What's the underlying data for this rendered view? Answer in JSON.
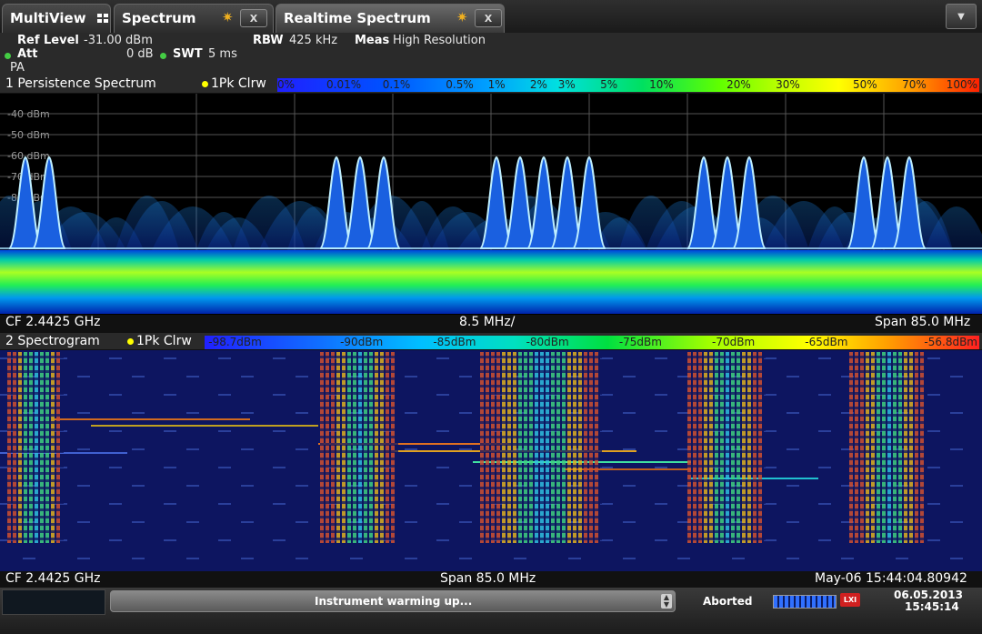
{
  "tabs": [
    {
      "label": "MultiView"
    },
    {
      "label": "Spectrum",
      "close": "X"
    },
    {
      "label": "Realtime Spectrum",
      "close": "X"
    }
  ],
  "menu_button": "▼",
  "params": {
    "ref_level_label": "Ref Level",
    "ref_level_value": "-31.00 dBm",
    "att_label": "Att",
    "att_value": "0 dB",
    "swt_label": "SWT",
    "swt_value": "5 ms",
    "rbw_label": "RBW",
    "rbw_value": "425 kHz",
    "meas_label": "Meas",
    "meas_value": "High Resolution",
    "pa_label": "PA"
  },
  "persistence": {
    "title": "1 Persistence Spectrum",
    "trace": "1Pk Clrw",
    "scale": [
      "0%",
      "0.01%",
      "0.1%",
      "0.5%",
      "1%",
      "2%",
      "3%",
      "5%",
      "10%",
      "20%",
      "30%",
      "50%",
      "70%",
      "100%"
    ],
    "y_ticks": [
      "-40 dBm",
      "-50 dBm",
      "-60 dBm",
      "-70 dBm",
      "-80 dBm"
    ],
    "footer": {
      "left": "CF 2.4425 GHz",
      "center": "8.5 MHz/",
      "right": "Span 85.0 MHz"
    }
  },
  "spectrogram": {
    "title": "2 Spectrogram",
    "trace": "1Pk Clrw",
    "scale": [
      "-98.7dBm",
      "-90dBm",
      "-85dBm",
      "-80dBm",
      "-75dBm",
      "-70dBm",
      "-65dBm",
      "-56.8dBm"
    ],
    "footer": {
      "left": "CF 2.4425 GHz",
      "center": "Span 85.0 MHz",
      "right": "May-06 15:44:04.80942"
    }
  },
  "status": {
    "message": "Instrument warming up...",
    "state": "Aborted",
    "date": "06.05.2013",
    "time": "15:45:14",
    "lxi": "LXI"
  }
}
